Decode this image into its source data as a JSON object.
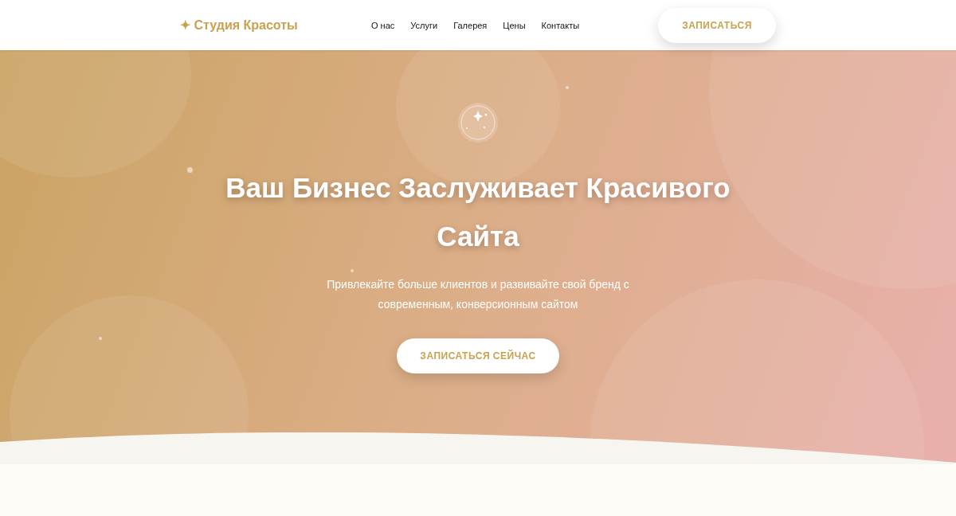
{
  "header": {
    "logo": "✦ Студия Красоты",
    "nav": [
      "О нас",
      "Услуги",
      "Галерея",
      "Цены",
      "Контакты"
    ],
    "cta": "ЗАПИСАТЬСЯ"
  },
  "hero": {
    "title": "Ваш Бизнес Заслуживает Красивого Сайта",
    "subtitle": "Привлекайте больше клиентов и развивайте свой бренд с современным, конверсионным сайтом",
    "cta": "ЗАПИСАТЬСЯ СЕЙЧАС"
  }
}
